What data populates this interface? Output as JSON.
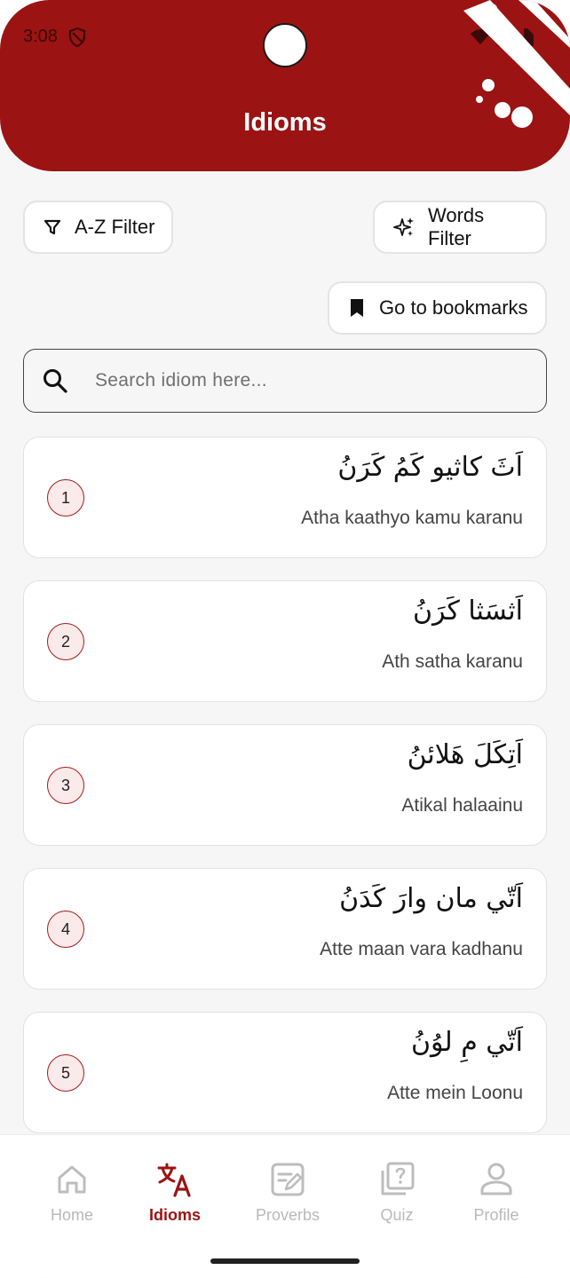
{
  "status_bar": {
    "time": "3:08"
  },
  "header": {
    "title": "Idioms"
  },
  "filters": {
    "az_label": "A-Z Filter",
    "words_label": "Words Filter",
    "bookmarks_label": "Go to bookmarks"
  },
  "search": {
    "placeholder": "Search idiom here..."
  },
  "idioms": [
    {
      "number": "1",
      "arabic": "اَثَ كاثيو كَمُ كَرَنُ",
      "roman": "Atha kaathyo kamu karanu"
    },
    {
      "number": "2",
      "arabic": "اَثسَثا كَرَنُ",
      "roman": "Ath satha karanu"
    },
    {
      "number": "3",
      "arabic": "اَتِكَلَ هَلائنُ",
      "roman": "Atikal halaainu"
    },
    {
      "number": "4",
      "arabic": "اَتّي مان وارَ كَدَنُ",
      "roman": "Atte maan vara kadhanu"
    },
    {
      "number": "5",
      "arabic": "اَتّي مِ لوُنُ",
      "roman": "Atte mein Loonu"
    }
  ],
  "nav": {
    "items": [
      {
        "label": "Home",
        "icon": "home-icon"
      },
      {
        "label": "Idioms",
        "icon": "translate-icon"
      },
      {
        "label": "Proverbs",
        "icon": "edit-note-icon"
      },
      {
        "label": "Quiz",
        "icon": "quiz-icon"
      },
      {
        "label": "Profile",
        "icon": "person-icon"
      }
    ],
    "active": "Idioms"
  },
  "colors": {
    "brand": "#9b1313",
    "background": "#f6f6f6"
  }
}
